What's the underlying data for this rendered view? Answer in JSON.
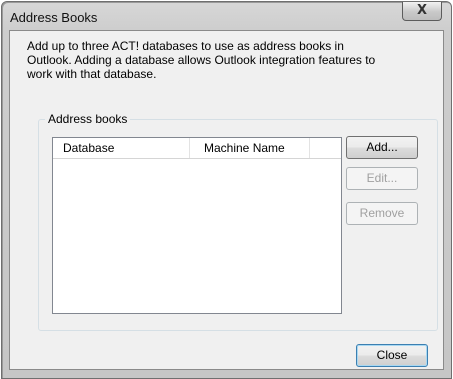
{
  "window": {
    "title": "Address Books",
    "close_glyph": "X"
  },
  "description": [
    "Add up to three ACT! databases to use as address books in",
    "Outlook.  Adding a database allows Outlook integration features to",
    "work with that database."
  ],
  "group": {
    "label": "Address books"
  },
  "table": {
    "columns": [
      "Database",
      "Machine Name",
      ""
    ],
    "rows": []
  },
  "buttons": {
    "add": "Add...",
    "edit": "Edit...",
    "remove": "Remove",
    "close": "Close"
  },
  "icons": {
    "close": "close-icon"
  }
}
